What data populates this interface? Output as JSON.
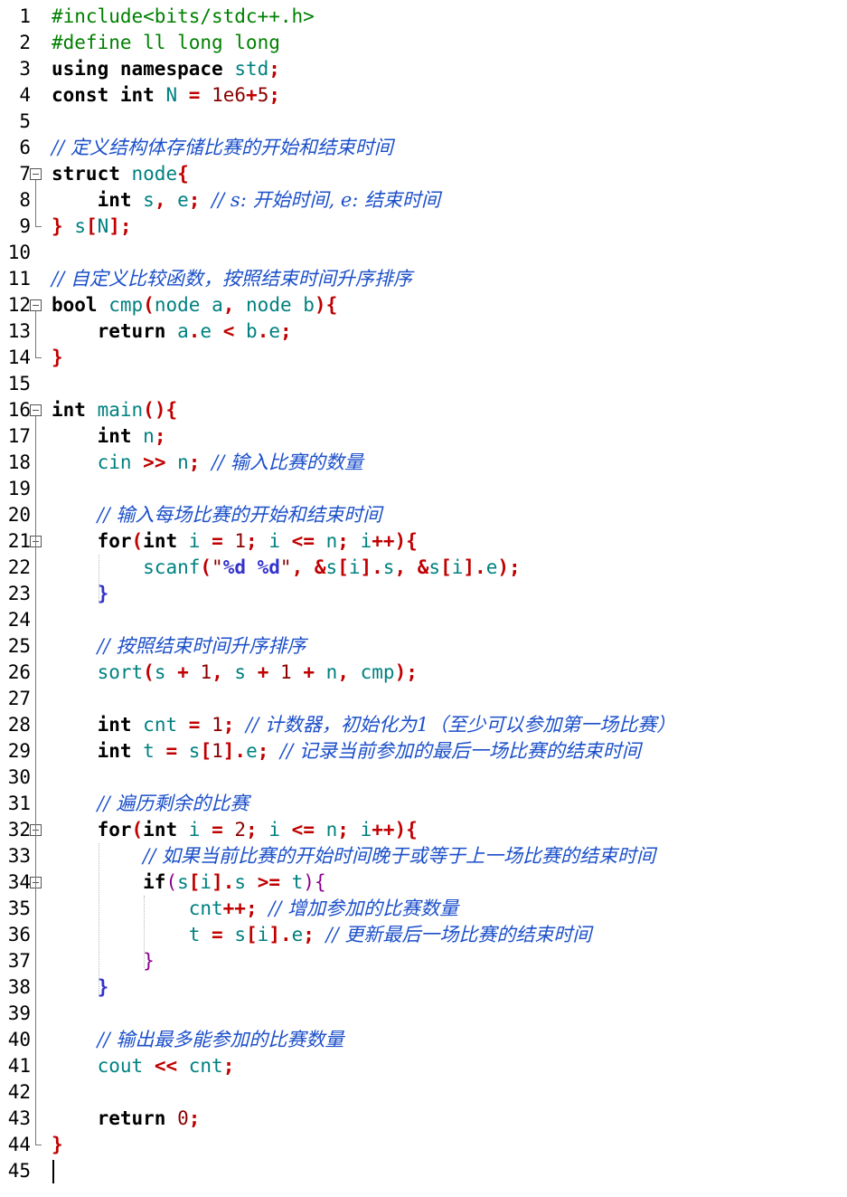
{
  "editor": {
    "current_line": 45,
    "lines": [
      {
        "n": "1",
        "tokens": [
          {
            "t": "#include<bits/stdc++.h>",
            "c": "pp"
          }
        ]
      },
      {
        "n": "2",
        "tokens": [
          {
            "t": "#define ll long long",
            "c": "pp"
          }
        ]
      },
      {
        "n": "3",
        "tokens": [
          {
            "t": "using",
            "c": "k"
          },
          {
            "t": " "
          },
          {
            "t": "namespace",
            "c": "k"
          },
          {
            "t": " "
          },
          {
            "t": "std",
            "c": "id"
          },
          {
            "t": ";",
            "c": "op"
          }
        ]
      },
      {
        "n": "4",
        "tokens": [
          {
            "t": "const",
            "c": "k"
          },
          {
            "t": " "
          },
          {
            "t": "int",
            "c": "k"
          },
          {
            "t": " "
          },
          {
            "t": "N",
            "c": "id"
          },
          {
            "t": " "
          },
          {
            "t": "=",
            "c": "op"
          },
          {
            "t": " "
          },
          {
            "t": "1e6",
            "c": "num"
          },
          {
            "t": "+",
            "c": "op"
          },
          {
            "t": "5",
            "c": "num"
          },
          {
            "t": ";",
            "c": "op"
          }
        ]
      },
      {
        "n": "5",
        "tokens": []
      },
      {
        "n": "6",
        "tokens": [
          {
            "t": "// 定义结构体存储比赛的开始和结束时间",
            "c": "cm"
          }
        ]
      },
      {
        "n": "7",
        "tokens": [
          {
            "t": "struct",
            "c": "k"
          },
          {
            "t": " "
          },
          {
            "t": "node",
            "c": "id"
          },
          {
            "t": "{",
            "c": "op"
          }
        ]
      },
      {
        "n": "8",
        "tokens": [
          {
            "t": "    "
          },
          {
            "t": "int",
            "c": "k"
          },
          {
            "t": " "
          },
          {
            "t": "s",
            "c": "id"
          },
          {
            "t": ",",
            "c": "op"
          },
          {
            "t": " "
          },
          {
            "t": "e",
            "c": "id"
          },
          {
            "t": ";",
            "c": "op"
          },
          {
            "t": " "
          },
          {
            "t": "// s: 开始时间, e: 结束时间",
            "c": "cm"
          }
        ]
      },
      {
        "n": "9",
        "tokens": [
          {
            "t": "}",
            "c": "op"
          },
          {
            "t": " "
          },
          {
            "t": "s",
            "c": "id"
          },
          {
            "t": "[",
            "c": "op"
          },
          {
            "t": "N",
            "c": "id"
          },
          {
            "t": "];",
            "c": "op"
          }
        ]
      },
      {
        "n": "10",
        "tokens": []
      },
      {
        "n": "11",
        "tokens": [
          {
            "t": "// 自定义比较函数，按照结束时间升序排序",
            "c": "cm"
          }
        ]
      },
      {
        "n": "12",
        "tokens": [
          {
            "t": "bool",
            "c": "k"
          },
          {
            "t": " "
          },
          {
            "t": "cmp",
            "c": "id"
          },
          {
            "t": "(",
            "c": "op"
          },
          {
            "t": "node",
            "c": "id"
          },
          {
            "t": " "
          },
          {
            "t": "a",
            "c": "id"
          },
          {
            "t": ",",
            "c": "op"
          },
          {
            "t": " "
          },
          {
            "t": "node",
            "c": "id"
          },
          {
            "t": " "
          },
          {
            "t": "b",
            "c": "id"
          },
          {
            "t": "){",
            "c": "op"
          }
        ]
      },
      {
        "n": "13",
        "tokens": [
          {
            "t": "    "
          },
          {
            "t": "return",
            "c": "k"
          },
          {
            "t": " "
          },
          {
            "t": "a",
            "c": "id"
          },
          {
            "t": ".",
            "c": "op"
          },
          {
            "t": "e",
            "c": "id"
          },
          {
            "t": " "
          },
          {
            "t": "<",
            "c": "op"
          },
          {
            "t": " "
          },
          {
            "t": "b",
            "c": "id"
          },
          {
            "t": ".",
            "c": "op"
          },
          {
            "t": "e",
            "c": "id"
          },
          {
            "t": ";",
            "c": "op"
          }
        ]
      },
      {
        "n": "14",
        "tokens": [
          {
            "t": "}",
            "c": "op"
          }
        ]
      },
      {
        "n": "15",
        "tokens": []
      },
      {
        "n": "16",
        "tokens": [
          {
            "t": "int",
            "c": "k"
          },
          {
            "t": " "
          },
          {
            "t": "main",
            "c": "id"
          },
          {
            "t": "(){",
            "c": "op"
          }
        ]
      },
      {
        "n": "17",
        "tokens": [
          {
            "t": "    "
          },
          {
            "t": "int",
            "c": "k"
          },
          {
            "t": " "
          },
          {
            "t": "n",
            "c": "id"
          },
          {
            "t": ";",
            "c": "op"
          }
        ]
      },
      {
        "n": "18",
        "tokens": [
          {
            "t": "    "
          },
          {
            "t": "cin",
            "c": "id"
          },
          {
            "t": " "
          },
          {
            "t": ">>",
            "c": "op"
          },
          {
            "t": " "
          },
          {
            "t": "n",
            "c": "id"
          },
          {
            "t": ";",
            "c": "op"
          },
          {
            "t": " "
          },
          {
            "t": "// 输入比赛的数量",
            "c": "cm"
          }
        ]
      },
      {
        "n": "19",
        "tokens": []
      },
      {
        "n": "20",
        "tokens": [
          {
            "t": "    "
          },
          {
            "t": "// 输入每场比赛的开始和结束时间",
            "c": "cm"
          }
        ]
      },
      {
        "n": "21",
        "tokens": [
          {
            "t": "    "
          },
          {
            "t": "for",
            "c": "k"
          },
          {
            "t": "(",
            "c": "op"
          },
          {
            "t": "int",
            "c": "k"
          },
          {
            "t": " "
          },
          {
            "t": "i",
            "c": "id"
          },
          {
            "t": " "
          },
          {
            "t": "=",
            "c": "op"
          },
          {
            "t": " "
          },
          {
            "t": "1",
            "c": "num"
          },
          {
            "t": ";",
            "c": "op"
          },
          {
            "t": " "
          },
          {
            "t": "i",
            "c": "id"
          },
          {
            "t": " "
          },
          {
            "t": "<=",
            "c": "op"
          },
          {
            "t": " "
          },
          {
            "t": "n",
            "c": "id"
          },
          {
            "t": ";",
            "c": "op"
          },
          {
            "t": " "
          },
          {
            "t": "i",
            "c": "id"
          },
          {
            "t": "++){",
            "c": "op"
          }
        ]
      },
      {
        "n": "22",
        "tokens": [
          {
            "t": "        "
          },
          {
            "t": "scanf",
            "c": "id"
          },
          {
            "t": "(",
            "c": "op"
          },
          {
            "t": "\"",
            "c": "str"
          },
          {
            "t": "%d %d",
            "c": "bl"
          },
          {
            "t": "\"",
            "c": "str"
          },
          {
            "t": ",",
            "c": "op"
          },
          {
            "t": " "
          },
          {
            "t": "&",
            "c": "op"
          },
          {
            "t": "s",
            "c": "id"
          },
          {
            "t": "[",
            "c": "op"
          },
          {
            "t": "i",
            "c": "id"
          },
          {
            "t": "].",
            "c": "op"
          },
          {
            "t": "s",
            "c": "id"
          },
          {
            "t": ",",
            "c": "op"
          },
          {
            "t": " "
          },
          {
            "t": "&",
            "c": "op"
          },
          {
            "t": "s",
            "c": "id"
          },
          {
            "t": "[",
            "c": "op"
          },
          {
            "t": "i",
            "c": "id"
          },
          {
            "t": "].",
            "c": "op"
          },
          {
            "t": "e",
            "c": "id"
          },
          {
            "t": ");",
            "c": "op"
          }
        ]
      },
      {
        "n": "23",
        "tokens": [
          {
            "t": "    "
          },
          {
            "t": "}",
            "c": "bl"
          }
        ]
      },
      {
        "n": "24",
        "tokens": []
      },
      {
        "n": "25",
        "tokens": [
          {
            "t": "    "
          },
          {
            "t": "// 按照结束时间升序排序",
            "c": "cm"
          }
        ]
      },
      {
        "n": "26",
        "tokens": [
          {
            "t": "    "
          },
          {
            "t": "sort",
            "c": "id"
          },
          {
            "t": "(",
            "c": "op"
          },
          {
            "t": "s",
            "c": "id"
          },
          {
            "t": " "
          },
          {
            "t": "+",
            "c": "op"
          },
          {
            "t": " "
          },
          {
            "t": "1",
            "c": "num"
          },
          {
            "t": ",",
            "c": "op"
          },
          {
            "t": " "
          },
          {
            "t": "s",
            "c": "id"
          },
          {
            "t": " "
          },
          {
            "t": "+",
            "c": "op"
          },
          {
            "t": " "
          },
          {
            "t": "1",
            "c": "num"
          },
          {
            "t": " "
          },
          {
            "t": "+",
            "c": "op"
          },
          {
            "t": " "
          },
          {
            "t": "n",
            "c": "id"
          },
          {
            "t": ",",
            "c": "op"
          },
          {
            "t": " "
          },
          {
            "t": "cmp",
            "c": "id"
          },
          {
            "t": ");",
            "c": "op"
          }
        ]
      },
      {
        "n": "27",
        "tokens": []
      },
      {
        "n": "28",
        "tokens": [
          {
            "t": "    "
          },
          {
            "t": "int",
            "c": "k"
          },
          {
            "t": " "
          },
          {
            "t": "cnt",
            "c": "id"
          },
          {
            "t": " "
          },
          {
            "t": "=",
            "c": "op"
          },
          {
            "t": " "
          },
          {
            "t": "1",
            "c": "num"
          },
          {
            "t": ";",
            "c": "op"
          },
          {
            "t": " "
          },
          {
            "t": "// 计数器，初始化为1（至少可以参加第一场比赛）",
            "c": "cm"
          }
        ]
      },
      {
        "n": "29",
        "tokens": [
          {
            "t": "    "
          },
          {
            "t": "int",
            "c": "k"
          },
          {
            "t": " "
          },
          {
            "t": "t",
            "c": "id"
          },
          {
            "t": " "
          },
          {
            "t": "=",
            "c": "op"
          },
          {
            "t": " "
          },
          {
            "t": "s",
            "c": "id"
          },
          {
            "t": "[",
            "c": "op"
          },
          {
            "t": "1",
            "c": "num"
          },
          {
            "t": "].",
            "c": "op"
          },
          {
            "t": "e",
            "c": "id"
          },
          {
            "t": ";",
            "c": "op"
          },
          {
            "t": " "
          },
          {
            "t": "// 记录当前参加的最后一场比赛的结束时间",
            "c": "cm"
          }
        ]
      },
      {
        "n": "30",
        "tokens": []
      },
      {
        "n": "31",
        "tokens": [
          {
            "t": "    "
          },
          {
            "t": "// 遍历剩余的比赛",
            "c": "cm"
          }
        ]
      },
      {
        "n": "32",
        "tokens": [
          {
            "t": "    "
          },
          {
            "t": "for",
            "c": "k"
          },
          {
            "t": "(",
            "c": "op"
          },
          {
            "t": "int",
            "c": "k"
          },
          {
            "t": " "
          },
          {
            "t": "i",
            "c": "id"
          },
          {
            "t": " "
          },
          {
            "t": "=",
            "c": "op"
          },
          {
            "t": " "
          },
          {
            "t": "2",
            "c": "num"
          },
          {
            "t": ";",
            "c": "op"
          },
          {
            "t": " "
          },
          {
            "t": "i",
            "c": "id"
          },
          {
            "t": " "
          },
          {
            "t": "<=",
            "c": "op"
          },
          {
            "t": " "
          },
          {
            "t": "n",
            "c": "id"
          },
          {
            "t": ";",
            "c": "op"
          },
          {
            "t": " "
          },
          {
            "t": "i",
            "c": "id"
          },
          {
            "t": "++){",
            "c": "op"
          }
        ]
      },
      {
        "n": "33",
        "tokens": [
          {
            "t": "        "
          },
          {
            "t": "// 如果当前比赛的开始时间晚于或等于上一场比赛的结束时间",
            "c": "cm"
          }
        ]
      },
      {
        "n": "34",
        "tokens": [
          {
            "t": "        "
          },
          {
            "t": "if",
            "c": "k"
          },
          {
            "t": "(",
            "c": "vi"
          },
          {
            "t": "s",
            "c": "id"
          },
          {
            "t": "[",
            "c": "op"
          },
          {
            "t": "i",
            "c": "id"
          },
          {
            "t": "].",
            "c": "op"
          },
          {
            "t": "s",
            "c": "id"
          },
          {
            "t": " "
          },
          {
            "t": ">=",
            "c": "op"
          },
          {
            "t": " "
          },
          {
            "t": "t",
            "c": "id"
          },
          {
            "t": "){",
            "c": "vi"
          }
        ]
      },
      {
        "n": "35",
        "tokens": [
          {
            "t": "            "
          },
          {
            "t": "cnt",
            "c": "id"
          },
          {
            "t": "++;",
            "c": "op"
          },
          {
            "t": " "
          },
          {
            "t": "// 增加参加的比赛数量",
            "c": "cm"
          }
        ]
      },
      {
        "n": "36",
        "tokens": [
          {
            "t": "            "
          },
          {
            "t": "t",
            "c": "id"
          },
          {
            "t": " "
          },
          {
            "t": "=",
            "c": "op"
          },
          {
            "t": " "
          },
          {
            "t": "s",
            "c": "id"
          },
          {
            "t": "[",
            "c": "op"
          },
          {
            "t": "i",
            "c": "id"
          },
          {
            "t": "].",
            "c": "op"
          },
          {
            "t": "e",
            "c": "id"
          },
          {
            "t": ";",
            "c": "op"
          },
          {
            "t": " "
          },
          {
            "t": "// 更新最后一场比赛的结束时间",
            "c": "cm"
          }
        ]
      },
      {
        "n": "37",
        "tokens": [
          {
            "t": "        "
          },
          {
            "t": "}",
            "c": "vi"
          }
        ]
      },
      {
        "n": "38",
        "tokens": [
          {
            "t": "    "
          },
          {
            "t": "}",
            "c": "bl"
          }
        ]
      },
      {
        "n": "39",
        "tokens": []
      },
      {
        "n": "40",
        "tokens": [
          {
            "t": "    "
          },
          {
            "t": "// 输出最多能参加的比赛数量",
            "c": "cm"
          }
        ]
      },
      {
        "n": "41",
        "tokens": [
          {
            "t": "    "
          },
          {
            "t": "cout",
            "c": "id"
          },
          {
            "t": " "
          },
          {
            "t": "<<",
            "c": "op"
          },
          {
            "t": " "
          },
          {
            "t": "cnt",
            "c": "id"
          },
          {
            "t": ";",
            "c": "op"
          }
        ]
      },
      {
        "n": "42",
        "tokens": []
      },
      {
        "n": "43",
        "tokens": [
          {
            "t": "    "
          },
          {
            "t": "return",
            "c": "k"
          },
          {
            "t": " "
          },
          {
            "t": "0",
            "c": "num"
          },
          {
            "t": ";",
            "c": "op"
          }
        ]
      },
      {
        "n": "44",
        "tokens": [
          {
            "t": "}",
            "c": "op"
          }
        ]
      },
      {
        "n": "45",
        "tokens": []
      }
    ],
    "colors": {
      "keyword": "#000000",
      "preprocessor": "#008000",
      "identifier": "#008080",
      "operator": "#c00000",
      "number": "#8b0000",
      "comment": "#1b4fc9",
      "current_line_bg": "#d7f7f9"
    }
  }
}
